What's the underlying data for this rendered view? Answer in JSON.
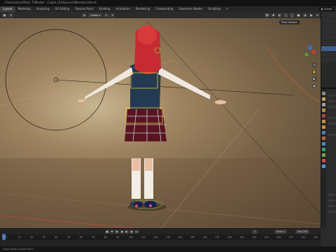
{
  "title_bar": "...Characters\\Pack 7\\Model - Copie (2)\\Source\\Blender.blend",
  "workspace_tabs": [
    "Layout",
    "Modeling",
    "Sculpting",
    "UV Editing",
    "Texture Paint",
    "Shading",
    "Animation",
    "Rendering",
    "Compositing",
    "Geometry Nodes",
    "Scripting",
    "+"
  ],
  "active_tab": "Layout",
  "scene_label": "Scene",
  "viewport_header": {
    "mode_label": "Global",
    "pose_options": "Pose Options"
  },
  "timeline": {
    "ruler": [
      "0",
      "10",
      "20",
      "30",
      "40",
      "50",
      "60",
      "70",
      "80",
      "90",
      "100",
      "110",
      "120",
      "130",
      "140",
      "150",
      "160",
      "170",
      "180",
      "190",
      "200",
      "210",
      "220",
      "230",
      "240",
      "250"
    ],
    "current_frame": "1",
    "start_label": "Start",
    "start_value": "1",
    "end_label": "End",
    "end_value": "250",
    "playhead": "1"
  },
  "status_bar": "Shape Model Context Menu",
  "colors": {
    "accent": "#4772b3",
    "selection_outline": "#e6c640",
    "bone_green": "#7ac93f"
  }
}
